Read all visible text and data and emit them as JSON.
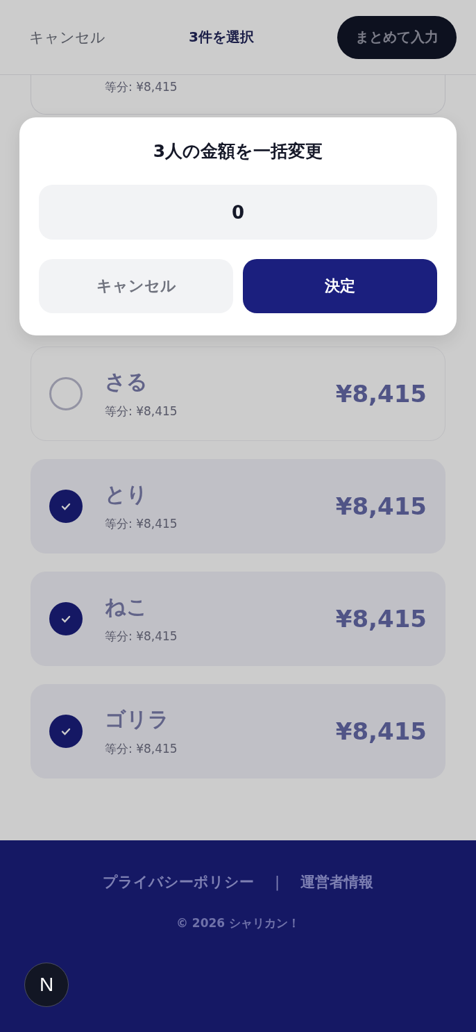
{
  "header": {
    "cancel": "キャンセル",
    "title": "3件を選択",
    "bulk_button": "まとめて入力"
  },
  "members": [
    {
      "kind": "partial",
      "sub": "等分: ¥8,415",
      "selected": false
    },
    {
      "name": "さる",
      "sub": "等分: ¥8,415",
      "amount": "¥8,415",
      "selected": false
    },
    {
      "name": "とり",
      "sub": "等分: ¥8,415",
      "amount": "¥8,415",
      "selected": true
    },
    {
      "name": "ねこ",
      "sub": "等分: ¥8,415",
      "amount": "¥8,415",
      "selected": true
    },
    {
      "name": "ゴリラ",
      "sub": "等分: ¥8,415",
      "amount": "¥8,415",
      "selected": true
    }
  ],
  "footer": {
    "links": [
      "プライバシーポリシー",
      "運営者情報"
    ],
    "separator": "|",
    "copyright": "© 2026 シャリカン！"
  },
  "dialog": {
    "title": "3人の金額を一括変更",
    "value": "0",
    "cancel": "キャンセル",
    "confirm": "決定"
  },
  "dev_badge": "N"
}
